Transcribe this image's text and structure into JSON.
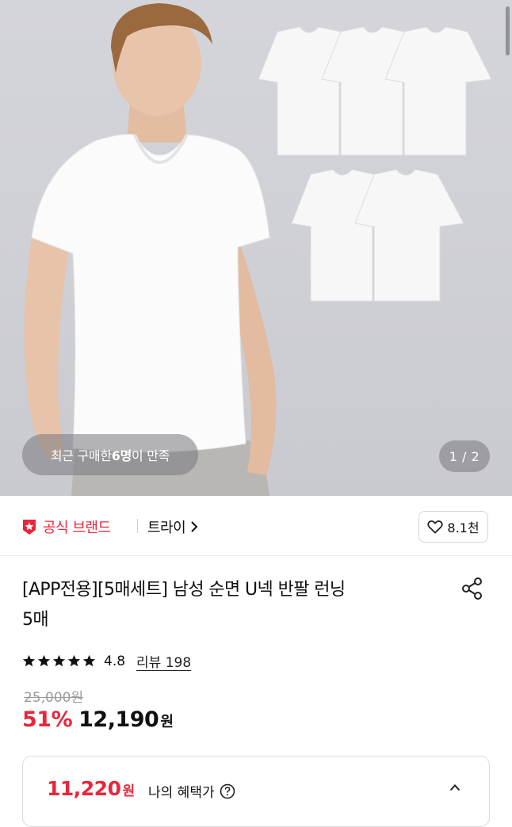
{
  "hero": {
    "recent_prefix": "최근 구매한 ",
    "recent_count": "6명",
    "recent_suffix": "이 만족",
    "page_indicator": "1 / 2"
  },
  "brand": {
    "badge_label": "공식 브랜드",
    "name": "트라이",
    "like_count": "8.1천"
  },
  "product": {
    "title_line1": "[APP전용][5매세트] 남성 순면 U넥 반팔 런닝",
    "title_line2": "5매",
    "rating": "4.8",
    "stars": 5,
    "review_label": "리뷰 198",
    "original_price": "25,000원",
    "discount": "51%",
    "price": "12,190",
    "currency": "원"
  },
  "benefit": {
    "price": "11,220",
    "currency": "원",
    "label": "나의 혜택가"
  },
  "colors": {
    "accent": "#e8273b",
    "text": "#111111",
    "muted": "#9a9a9a"
  },
  "icons": [
    "official-brand-icon",
    "chevron-right-icon",
    "heart-icon",
    "share-icon",
    "star-icon",
    "help-icon",
    "chevron-up-icon"
  ]
}
